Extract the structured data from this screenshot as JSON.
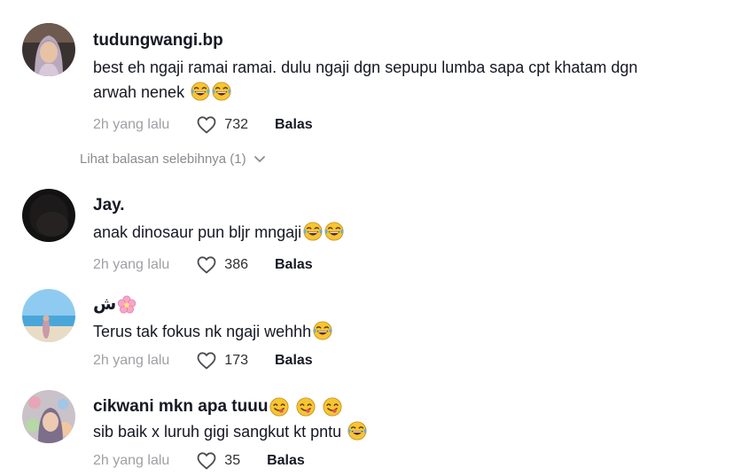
{
  "comments": [
    {
      "username": "tudungwangi.bp",
      "text_line1": "best eh ngaji ramai ramai. dulu ngaji dgn sepupu lumba sapa cpt khatam dgn",
      "text_line2": "arwah nenek",
      "emojis": [
        "laughing-tears-emoji",
        "laughing-tears-emoji"
      ],
      "time": "2h yang lalu",
      "likes": "732",
      "reply_label": "Balas"
    },
    {
      "username": "Jay.",
      "text": "anak dinosaur pun bljr mngaji",
      "emojis": [
        "laughing-tears-emoji",
        "laughing-tears-emoji"
      ],
      "time": "2h yang lalu",
      "likes": "386",
      "reply_label": "Balas"
    },
    {
      "username": "ش",
      "username_emoji": "cherry-blossom-emoji",
      "text": "Terus tak fokus nk ngaji wehhh",
      "emojis": [
        "laughing-tears-emoji"
      ],
      "time": "2h yang lalu",
      "likes": "173",
      "reply_label": "Balas"
    },
    {
      "username": "cikwani mkn apa tuuu",
      "username_emojis": [
        "yum-emoji",
        "yum-emoji",
        "yum-emoji"
      ],
      "text": "sib baik x luruh gigi sangkut kt pntu",
      "emojis": [
        "laughing-tears-emoji"
      ],
      "time": "2h yang lalu",
      "likes": "35",
      "reply_label": "Balas"
    }
  ],
  "view_more_replies": "Lihat balasan selebihnya (1)",
  "icons": {
    "like": "heart-outline-icon",
    "expand": "chevron-down-icon"
  },
  "colors": {
    "username": "#161823",
    "secondary": "#a0a0a5",
    "emoji_face": "#f7c531"
  }
}
